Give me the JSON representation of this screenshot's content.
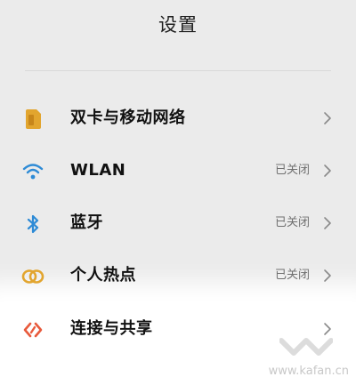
{
  "header": {
    "title": "设置"
  },
  "rows": [
    {
      "label": "双卡与移动网络",
      "status": "",
      "icon": "sim-card-icon",
      "color": "#e2a52e"
    },
    {
      "label": "WLAN",
      "status": "已关闭",
      "icon": "wifi-icon",
      "color": "#2e8bd6"
    },
    {
      "label": "蓝牙",
      "status": "已关闭",
      "icon": "bluetooth-icon",
      "color": "#2e8bd6"
    },
    {
      "label": "个人热点",
      "status": "已关闭",
      "icon": "hotspot-icon",
      "color": "#e2a52e"
    },
    {
      "label": "连接与共享",
      "status": "",
      "icon": "share-icon",
      "color": "#e85a3c"
    }
  ],
  "watermark": {
    "text": "www.kafan.cn"
  },
  "colors": {
    "background": "#ebebeb",
    "highlight": "#ffffff"
  }
}
